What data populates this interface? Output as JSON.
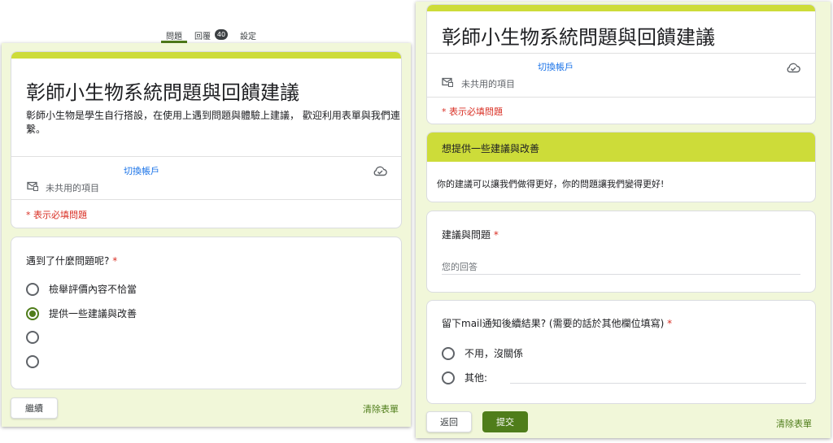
{
  "tabs": {
    "questions": "問題",
    "responses": "回覆",
    "responses_count": "40",
    "settings": "設定"
  },
  "left": {
    "form_title": "彰師小生物系統問題與回饋建議",
    "form_description": "彰師小生物是學生自行搭設，在使用上遇到問題與體驗上建議， 歡迎利用表單與我們連繫。",
    "switch_account": "切換帳戶",
    "not_shared": "未共用的項目",
    "required_note": "* 表示必填問題",
    "question": {
      "title": "遇到了什麼問題呢?",
      "required_mark": "*",
      "options": [
        {
          "label": "檢舉評價內容不恰當",
          "selected": false
        },
        {
          "label": "提供一些建議與改善",
          "selected": true
        },
        {
          "label": "",
          "selected": false
        },
        {
          "label": "",
          "selected": false
        }
      ]
    },
    "continue_button": "繼續",
    "clear_form": "清除表單"
  },
  "right": {
    "form_title": "彰師小生物系統問題與回饋建議",
    "switch_account": "切換帳戶",
    "not_shared": "未共用的項目",
    "required_note": "* 表示必填問題",
    "section_title": "想提供一些建議與改善",
    "section_description": "你的建議可以讓我們做得更好，你的問題讓我們變得更好!",
    "q1": {
      "title": "建議與問題",
      "required_mark": "*",
      "placeholder": "您的回答"
    },
    "q2": {
      "title": "留下mail通知後續結果? (需要的話於其他欄位填寫)",
      "required_mark": "*",
      "options": [
        {
          "label": "不用，沒關係"
        },
        {
          "label": "其他:"
        }
      ]
    },
    "back_button": "返回",
    "submit_button": "提交",
    "clear_form": "清除表單"
  },
  "colors": {
    "accent": "#cddc39",
    "primary": "#4f7d1a",
    "background": "#f1f7d9",
    "required": "#d93025",
    "link": "#1a73e8"
  }
}
